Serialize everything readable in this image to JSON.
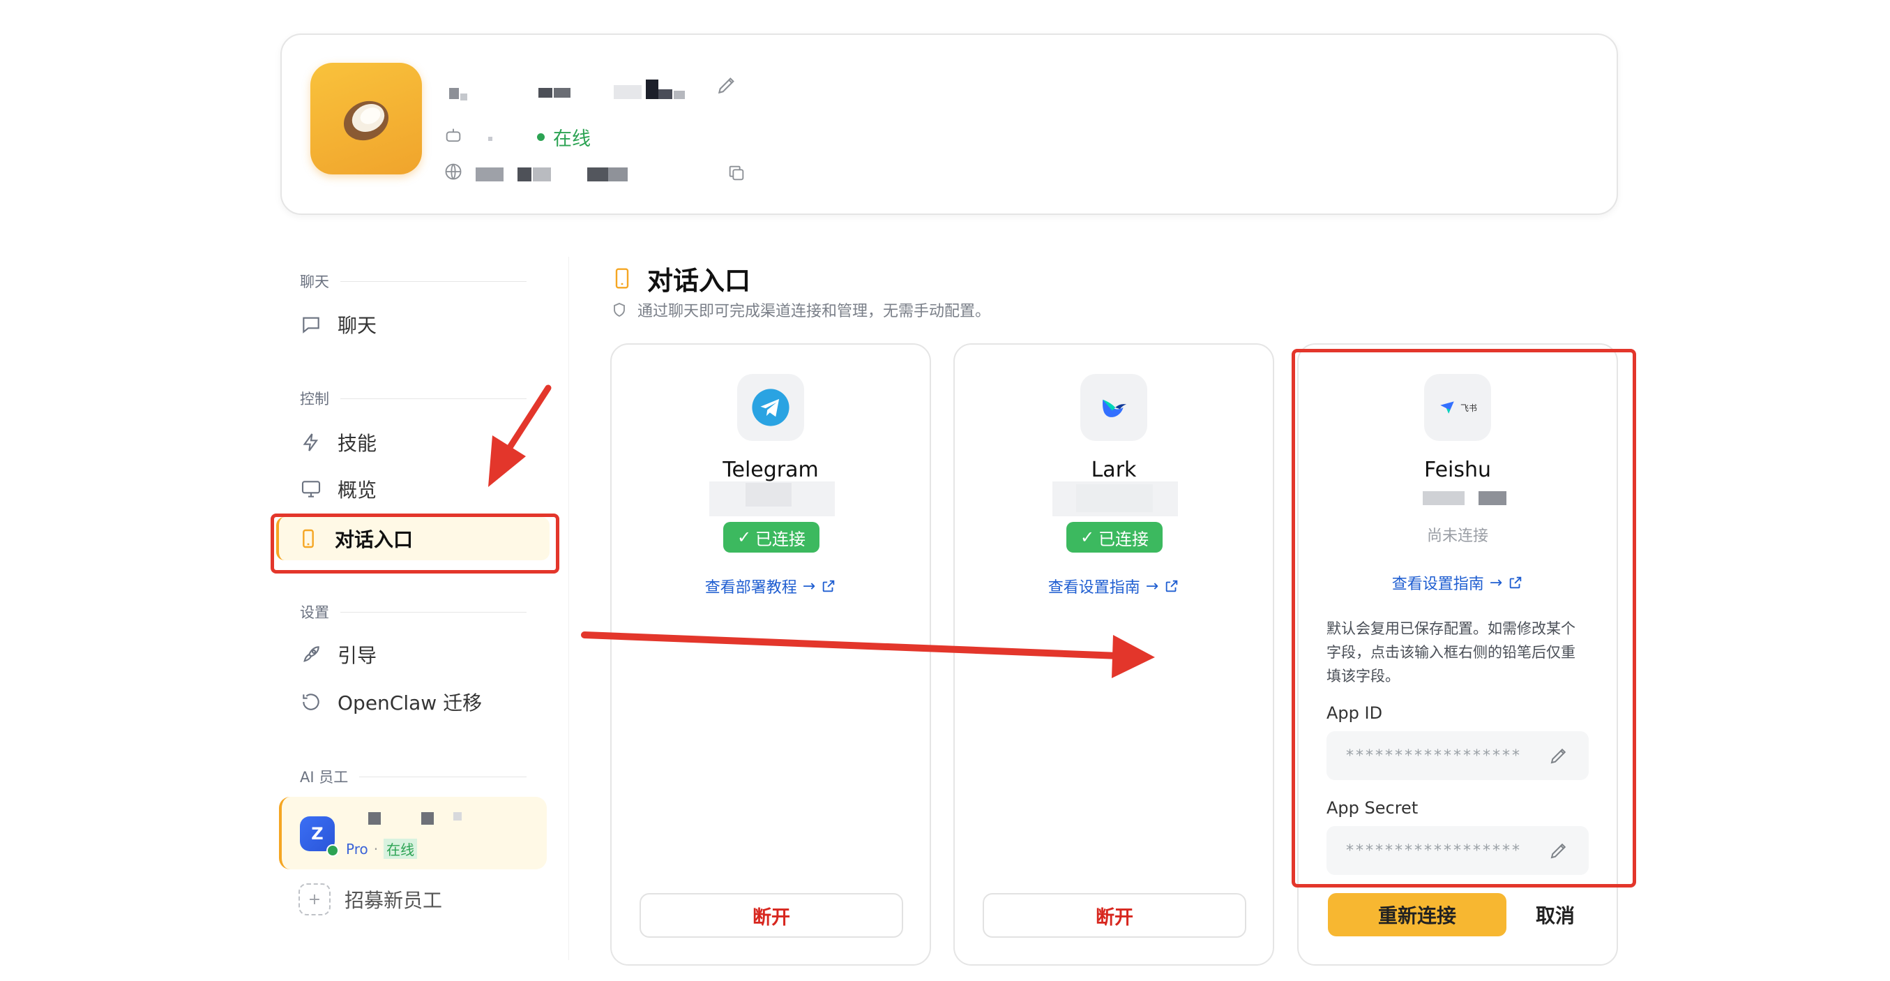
{
  "profile": {
    "status": "在线"
  },
  "sidebar": {
    "sections": [
      {
        "title": "聊天",
        "items": [
          {
            "label": "聊天",
            "icon": "chat-icon"
          }
        ]
      },
      {
        "title": "控制",
        "items": [
          {
            "label": "技能",
            "icon": "lightning-icon"
          },
          {
            "label": "概览",
            "icon": "monitor-icon"
          },
          {
            "label": "对话入口",
            "icon": "phone-icon",
            "active": true
          }
        ]
      },
      {
        "title": "设置",
        "items": [
          {
            "label": "引导",
            "icon": "rocket-icon"
          },
          {
            "label": "OpenClaw 迁移",
            "icon": "history-icon"
          }
        ]
      },
      {
        "title": "AI 员工"
      }
    ],
    "employee": {
      "avatar_letter": "Z",
      "plan": "Pro",
      "sep": "·",
      "status": "在线"
    },
    "recruit": "招募新员工"
  },
  "main": {
    "title": "对话入口",
    "desc": "通过聊天即可完成渠道连接和管理，无需手动配置。"
  },
  "channels": [
    {
      "name": "Telegram",
      "badge": "已连接",
      "link": "查看部署教程",
      "action": "断开",
      "icon": "telegram-icon"
    },
    {
      "name": "Lark",
      "badge": "已连接",
      "link": "查看设置指南",
      "action": "断开",
      "icon": "lark-icon"
    },
    {
      "name": "Feishu",
      "status": "尚未连接",
      "link": "查看设置指南",
      "icon": "feishu-icon",
      "logo_text": "飞书",
      "note_lines": [
        "默认会复用已保存配置。如需修改某个",
        "字段，点击该输入框右侧的铅笔后仅重",
        "填该字段。"
      ],
      "fields": [
        {
          "label": "App ID",
          "value": "******************"
        },
        {
          "label": "App Secret",
          "value": "******************"
        }
      ],
      "primary_action": "重新连接",
      "secondary_action": "取消"
    }
  ],
  "colors": {
    "accent": "#f7b731",
    "online": "#2ca353",
    "connected": "#3cb95f",
    "danger": "#d7261e",
    "annotation": "#e3362b",
    "link": "#1f5ed1"
  }
}
